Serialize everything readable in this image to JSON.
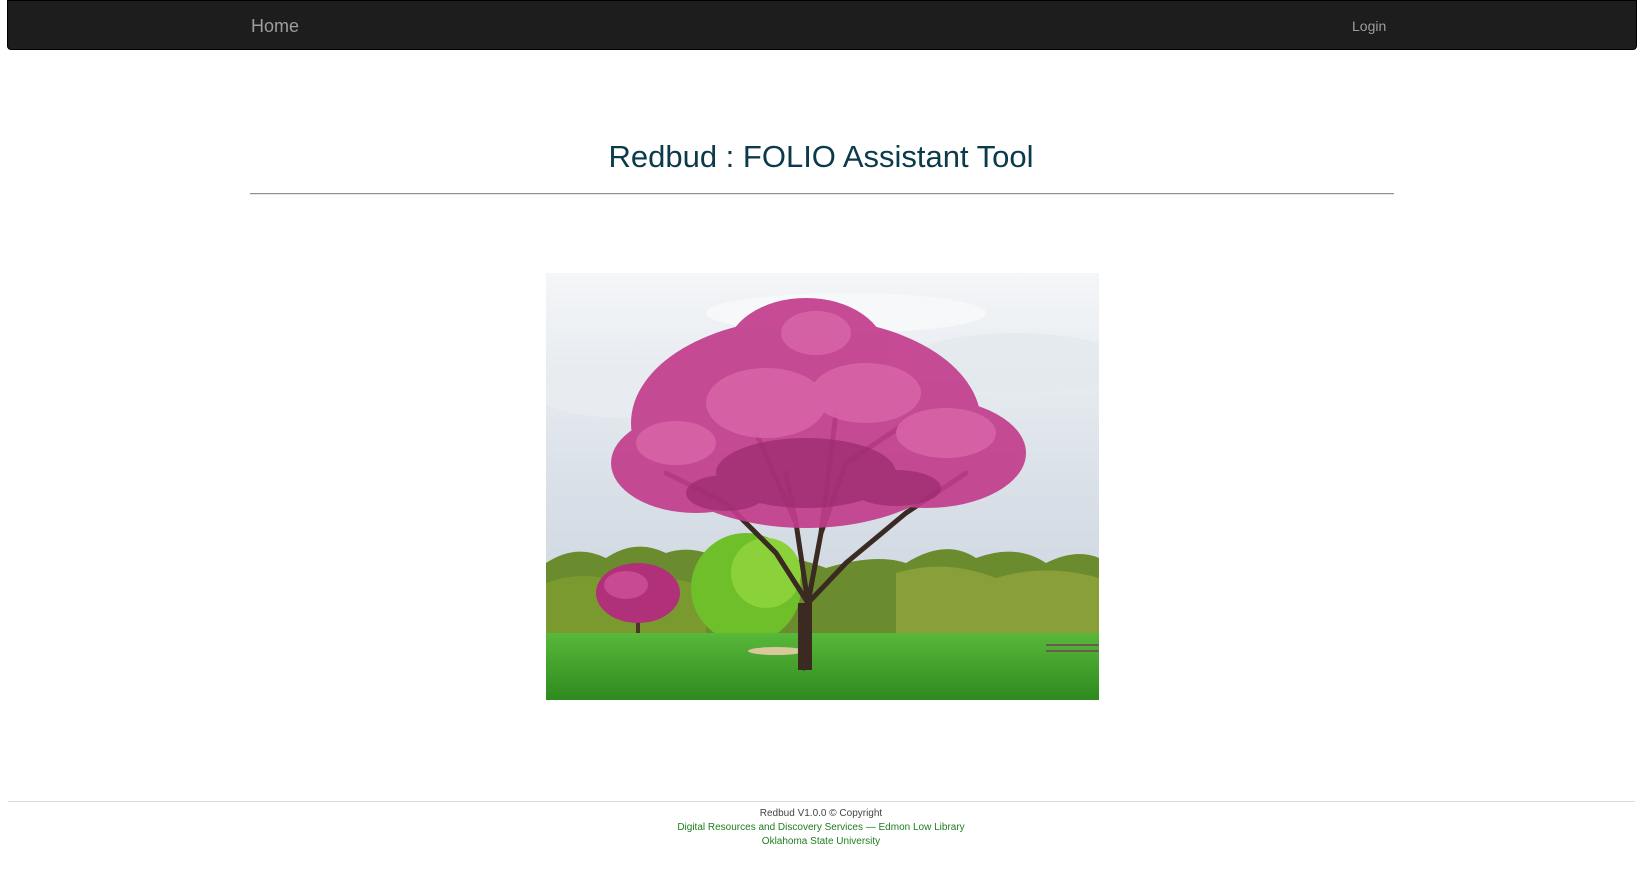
{
  "nav": {
    "home_label": "Home",
    "login_label": "Login"
  },
  "main": {
    "title": "Redbud : FOLIO Assistant Tool",
    "hero_icon": "redbud-tree-photo"
  },
  "footer": {
    "copyright": "Redbud V1.0.0 © Copyright",
    "department_link": "Digital Resources and Discovery Services — Edmon Low Library",
    "university_link": "Oklahoma State University"
  },
  "colors": {
    "navbar_bg": "#1d1d1d",
    "nav_text": "#9d9d9d",
    "title_text": "#0b3a4a",
    "footer_link": "#1e7d1e"
  }
}
